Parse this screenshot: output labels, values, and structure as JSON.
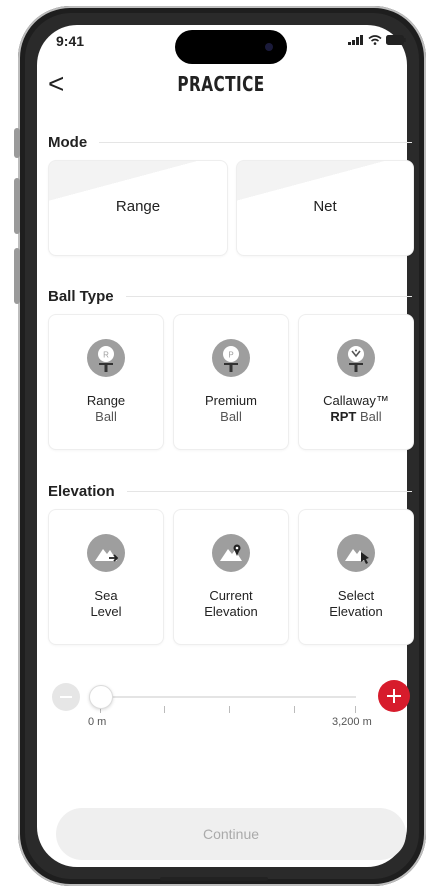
{
  "status_bar": {
    "time": "9:41",
    "signal_icon": "signal-icon",
    "wifi_icon": "wifi-icon",
    "battery_icon": "battery-icon"
  },
  "header": {
    "title": "PRACTICE",
    "back_glyph": "<"
  },
  "mode": {
    "heading": "Mode",
    "options": [
      {
        "label": "Range"
      },
      {
        "label": "Net"
      }
    ]
  },
  "ball_type": {
    "heading": "Ball Type",
    "options": [
      {
        "line1": "Range",
        "line2": "Ball",
        "icon_letter": "R"
      },
      {
        "line1": "Premium",
        "line2": "Ball",
        "icon_letter": "P"
      },
      {
        "line1": "Callaway™",
        "line2_bold": "RPT",
        "line2": " Ball"
      }
    ]
  },
  "elevation": {
    "heading": "Elevation",
    "options": [
      {
        "line1": "Sea",
        "line2": "Level",
        "icon": "mountain-arrow-icon"
      },
      {
        "line1": "Current",
        "line2": "Elevation",
        "icon": "mountain-pin-icon"
      },
      {
        "line1": "Select",
        "line2": "Elevation",
        "icon": "mountain-pointer-icon"
      }
    ]
  },
  "slider": {
    "min_label": "0 m",
    "max_label": "3,200 m",
    "value_fraction": 0
  },
  "footer": {
    "continue_label": "Continue"
  },
  "colors": {
    "accent": "#d71c2c",
    "icon_grey": "#9e9e9e",
    "disabled_bg": "#efefef"
  }
}
